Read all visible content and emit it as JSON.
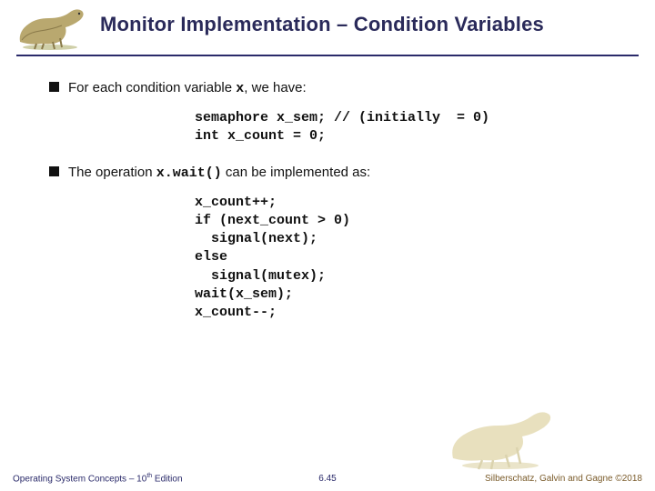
{
  "header": {
    "title": "Monitor Implementation – Condition Variables"
  },
  "bullets": {
    "b1_pre": "For each condition variable ",
    "b1_var": "x",
    "b1_post": ", we  have:",
    "code1": "semaphore x_sem; // (initially  = 0)\nint x_count = 0;",
    "b2_pre": "The operation ",
    "b2_code": "x.wait()",
    "b2_post": "  can be implemented as:",
    "code2": "x_count++;\nif (next_count > 0)\n  signal(next);\nelse\n  signal(mutex);\nwait(x_sem);\nx_count--;"
  },
  "footer": {
    "left_a": "Operating System Concepts – 10",
    "left_sup": "th",
    "left_b": " Edition",
    "center": "6.45",
    "right": "Silberschatz, Galvin and Gagne ©2018"
  }
}
